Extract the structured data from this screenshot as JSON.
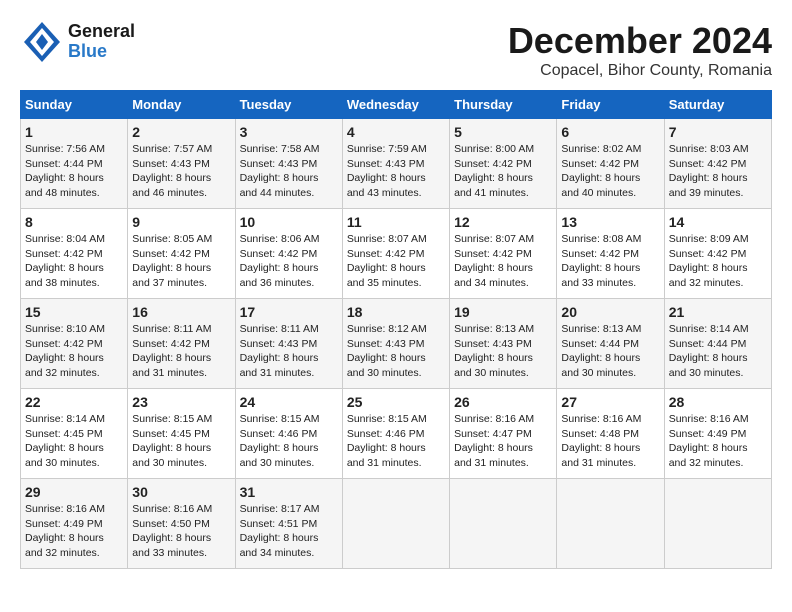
{
  "header": {
    "logo_line1": "General",
    "logo_line2": "Blue",
    "title": "December 2024",
    "subtitle": "Copacel, Bihor County, Romania"
  },
  "calendar": {
    "days_of_week": [
      "Sunday",
      "Monday",
      "Tuesday",
      "Wednesday",
      "Thursday",
      "Friday",
      "Saturday"
    ],
    "weeks": [
      [
        {
          "day": "",
          "info": ""
        },
        {
          "day": "2",
          "info": "Sunrise: 7:57 AM\nSunset: 4:43 PM\nDaylight: 8 hours and 46 minutes."
        },
        {
          "day": "3",
          "info": "Sunrise: 7:58 AM\nSunset: 4:43 PM\nDaylight: 8 hours and 44 minutes."
        },
        {
          "day": "4",
          "info": "Sunrise: 7:59 AM\nSunset: 4:43 PM\nDaylight: 8 hours and 43 minutes."
        },
        {
          "day": "5",
          "info": "Sunrise: 8:00 AM\nSunset: 4:42 PM\nDaylight: 8 hours and 41 minutes."
        },
        {
          "day": "6",
          "info": "Sunrise: 8:02 AM\nSunset: 4:42 PM\nDaylight: 8 hours and 40 minutes."
        },
        {
          "day": "7",
          "info": "Sunrise: 8:03 AM\nSunset: 4:42 PM\nDaylight: 8 hours and 39 minutes."
        }
      ],
      [
        {
          "day": "1",
          "info": "Sunrise: 7:56 AM\nSunset: 4:44 PM\nDaylight: 8 hours and 48 minutes.",
          "first_week_sunday": true
        },
        {
          "day": "8",
          "info": ""
        },
        {
          "day": "9",
          "info": ""
        },
        {
          "day": "10",
          "info": ""
        },
        {
          "day": "11",
          "info": ""
        },
        {
          "day": "12",
          "info": ""
        },
        {
          "day": "13",
          "info": ""
        },
        {
          "day": "14",
          "info": ""
        }
      ],
      [
        {
          "day": "8",
          "info": "Sunrise: 8:04 AM\nSunset: 4:42 PM\nDaylight: 8 hours and 38 minutes."
        },
        {
          "day": "9",
          "info": "Sunrise: 8:05 AM\nSunset: 4:42 PM\nDaylight: 8 hours and 37 minutes."
        },
        {
          "day": "10",
          "info": "Sunrise: 8:06 AM\nSunset: 4:42 PM\nDaylight: 8 hours and 36 minutes."
        },
        {
          "day": "11",
          "info": "Sunrise: 8:07 AM\nSunset: 4:42 PM\nDaylight: 8 hours and 35 minutes."
        },
        {
          "day": "12",
          "info": "Sunrise: 8:07 AM\nSunset: 4:42 PM\nDaylight: 8 hours and 34 minutes."
        },
        {
          "day": "13",
          "info": "Sunrise: 8:08 AM\nSunset: 4:42 PM\nDaylight: 8 hours and 33 minutes."
        },
        {
          "day": "14",
          "info": "Sunrise: 8:09 AM\nSunset: 4:42 PM\nDaylight: 8 hours and 32 minutes."
        }
      ],
      [
        {
          "day": "15",
          "info": "Sunrise: 8:10 AM\nSunset: 4:42 PM\nDaylight: 8 hours and 32 minutes."
        },
        {
          "day": "16",
          "info": "Sunrise: 8:11 AM\nSunset: 4:42 PM\nDaylight: 8 hours and 31 minutes."
        },
        {
          "day": "17",
          "info": "Sunrise: 8:11 AM\nSunset: 4:43 PM\nDaylight: 8 hours and 31 minutes."
        },
        {
          "day": "18",
          "info": "Sunrise: 8:12 AM\nSunset: 4:43 PM\nDaylight: 8 hours and 30 minutes."
        },
        {
          "day": "19",
          "info": "Sunrise: 8:13 AM\nSunset: 4:43 PM\nDaylight: 8 hours and 30 minutes."
        },
        {
          "day": "20",
          "info": "Sunrise: 8:13 AM\nSunset: 4:44 PM\nDaylight: 8 hours and 30 minutes."
        },
        {
          "day": "21",
          "info": "Sunrise: 8:14 AM\nSunset: 4:44 PM\nDaylight: 8 hours and 30 minutes."
        }
      ],
      [
        {
          "day": "22",
          "info": "Sunrise: 8:14 AM\nSunset: 4:45 PM\nDaylight: 8 hours and 30 minutes."
        },
        {
          "day": "23",
          "info": "Sunrise: 8:15 AM\nSunset: 4:45 PM\nDaylight: 8 hours and 30 minutes."
        },
        {
          "day": "24",
          "info": "Sunrise: 8:15 AM\nSunset: 4:46 PM\nDaylight: 8 hours and 30 minutes."
        },
        {
          "day": "25",
          "info": "Sunrise: 8:15 AM\nSunset: 4:46 PM\nDaylight: 8 hours and 31 minutes."
        },
        {
          "day": "26",
          "info": "Sunrise: 8:16 AM\nSunset: 4:47 PM\nDaylight: 8 hours and 31 minutes."
        },
        {
          "day": "27",
          "info": "Sunrise: 8:16 AM\nSunset: 4:48 PM\nDaylight: 8 hours and 31 minutes."
        },
        {
          "day": "28",
          "info": "Sunrise: 8:16 AM\nSunset: 4:49 PM\nDaylight: 8 hours and 32 minutes."
        }
      ],
      [
        {
          "day": "29",
          "info": "Sunrise: 8:16 AM\nSunset: 4:49 PM\nDaylight: 8 hours and 32 minutes."
        },
        {
          "day": "30",
          "info": "Sunrise: 8:16 AM\nSunset: 4:50 PM\nDaylight: 8 hours and 33 minutes."
        },
        {
          "day": "31",
          "info": "Sunrise: 8:17 AM\nSunset: 4:51 PM\nDaylight: 8 hours and 34 minutes."
        },
        {
          "day": "",
          "info": ""
        },
        {
          "day": "",
          "info": ""
        },
        {
          "day": "",
          "info": ""
        },
        {
          "day": "",
          "info": ""
        }
      ]
    ]
  }
}
